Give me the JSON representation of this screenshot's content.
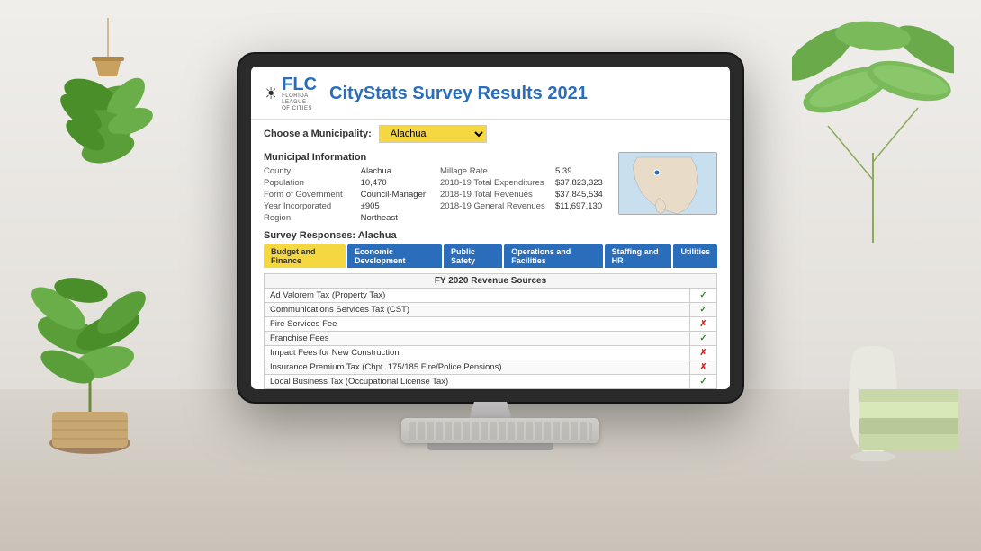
{
  "app": {
    "title": "CityStats Survey Results 2021",
    "org_short": "FLC",
    "org_full_line1": "FLORIDA",
    "org_full_line2": "LEAGUE",
    "org_full_line3": "OF CITIES"
  },
  "municipality": {
    "label": "Choose a Municipality:",
    "selected": "Alachua"
  },
  "municipal_info": {
    "section_title": "Municipal Information",
    "left": {
      "county_label": "County",
      "county_value": "Alachua",
      "population_label": "Population",
      "population_value": "10,470",
      "form_label": "Form of Government",
      "form_value": "Council-Manager",
      "year_label": "Year Incorporated",
      "year_value": "±905",
      "region_label": "Region",
      "region_value": "Northeast"
    },
    "right": {
      "millage_label": "Millage Rate",
      "millage_value": "5.39",
      "expenditures_label": "2018-19 Total Expenditures",
      "expenditures_value": "$37,823,323",
      "revenues_label": "2018-19 Total Revenues",
      "revenues_value": "$37,845,534",
      "gen_revenues_label": "2018-19 General Revenues",
      "gen_revenues_value": "$11,697,130"
    }
  },
  "survey": {
    "label": "Survey Responses:",
    "municipality": "Alachua",
    "tabs": [
      {
        "label": "Budget and Finance",
        "active": true
      },
      {
        "label": "Economic Development",
        "active": false
      },
      {
        "label": "Public Safety",
        "active": false
      },
      {
        "label": "Operations and Facilities",
        "active": false
      },
      {
        "label": "Staffing and HR",
        "active": false
      },
      {
        "label": "Utilities",
        "active": false
      }
    ],
    "table_title": "FY 2020 Revenue Sources",
    "rows": [
      {
        "name": "Ad Valorem Tax (Property Tax)",
        "status": "check"
      },
      {
        "name": "Communications Services Tax (CST)",
        "status": "check"
      },
      {
        "name": "Fire Services Fee",
        "status": "cross"
      },
      {
        "name": "Franchise Fees",
        "status": "check"
      },
      {
        "name": "Impact Fees for New Construction",
        "status": "cross"
      },
      {
        "name": "Insurance Premium Tax (Chpt. 175/185 Fire/Police Pensions)",
        "status": "cross"
      },
      {
        "name": "Local Business Tax (Occupational License Tax)",
        "status": "check"
      }
    ]
  },
  "icons": {
    "check": "✓",
    "cross": "✗",
    "sun": "☀"
  }
}
